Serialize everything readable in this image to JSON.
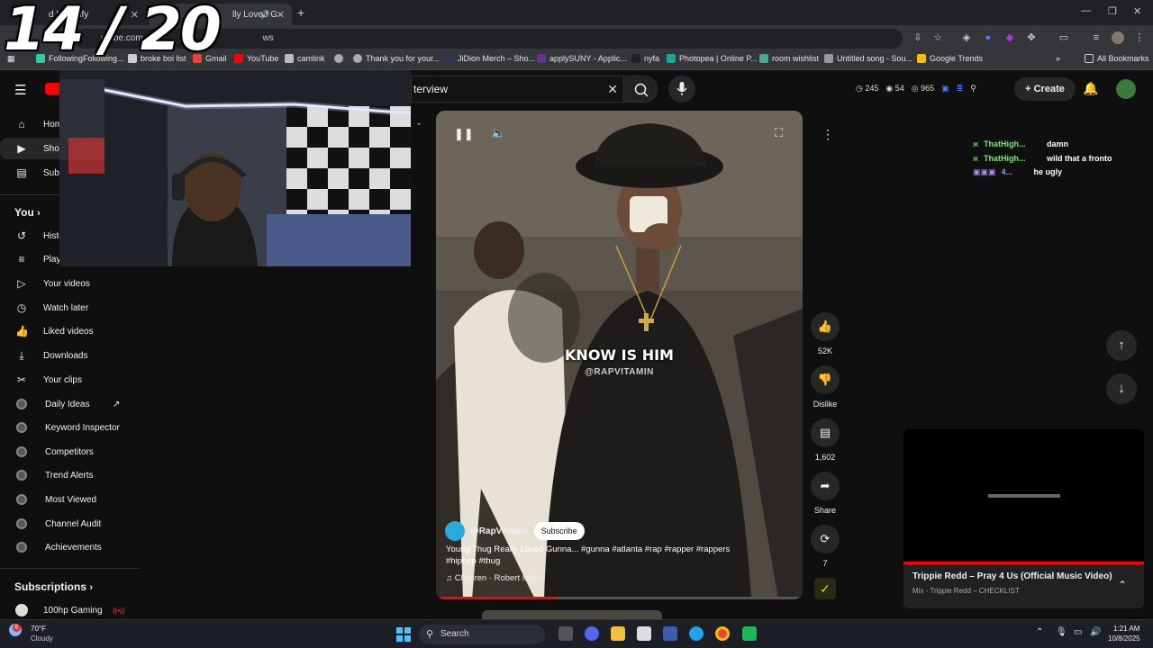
{
  "overlay": {
    "counter": "14 / 20"
  },
  "browser": {
    "tabs": [
      {
        "label": "d | Spotify",
        "active": false
      },
      {
        "label": "lly Loved G",
        "active": true
      }
    ],
    "new_tab": "+",
    "url": "utube.com",
    "url_suffix": "ws",
    "bookmarks": [
      {
        "label": "FollowingFollowing...",
        "color": "#3c9"
      },
      {
        "label": "broke boi list",
        "color": "#ccc"
      },
      {
        "label": "Gmail",
        "color": "#ea4335"
      },
      {
        "label": "YouTube",
        "color": "#f00"
      },
      {
        "label": "camlink",
        "color": "#bbb"
      },
      {
        "label": "",
        "color": "#aaa"
      },
      {
        "label": "Thank you for your...",
        "color": "#aaa"
      },
      {
        "label": "JiDion Merch – Sho...",
        "color": "#335"
      },
      {
        "label": "applySUNY - Applic...",
        "color": "#639"
      },
      {
        "label": "nyfa",
        "color": "#222"
      },
      {
        "label": "Photopea | Online P...",
        "color": "#1a9"
      },
      {
        "label": "room wishlist",
        "color": "#4a8"
      },
      {
        "label": "Untitled song - Sou...",
        "color": "#999"
      },
      {
        "label": "Google Trends",
        "color": "#fbbc04"
      }
    ],
    "all_bookmarks": "All Bookmarks"
  },
  "header": {
    "search_value": "terview",
    "stats": [
      "245",
      "54",
      "965"
    ],
    "create_label": "Create"
  },
  "sidebar": {
    "top_items": [
      {
        "label": "Hom",
        "icon": "home-icon"
      },
      {
        "label": "Shor",
        "icon": "shorts-icon"
      },
      {
        "label": "Subs",
        "icon": "subscriptions-icon"
      }
    ],
    "you_heading": "You",
    "you_items": [
      {
        "label": "Histo",
        "icon": "history-icon"
      },
      {
        "label": "Playl",
        "icon": "playlist-icon"
      },
      {
        "label": "Your videos",
        "icon": "video-icon"
      },
      {
        "label": "Watch later",
        "icon": "clock-icon"
      },
      {
        "label": "Liked videos",
        "icon": "thumbs-up-icon"
      },
      {
        "label": "Downloads",
        "icon": "download-icon"
      },
      {
        "label": "Your clips",
        "icon": "scissors-icon"
      }
    ],
    "tool_items": [
      {
        "label": "Daily Ideas"
      },
      {
        "label": "Keyword Inspector"
      },
      {
        "label": "Competitors"
      },
      {
        "label": "Trend Alerts"
      },
      {
        "label": "Most Viewed"
      },
      {
        "label": "Channel Audit"
      },
      {
        "label": "Achievements"
      }
    ],
    "subscriptions_heading": "Subscriptions",
    "subscription_items": [
      {
        "label": "100hp Gaming"
      }
    ]
  },
  "video": {
    "caption_big": "KNOW IS HIM",
    "caption_small": "@RAPVITAMIN",
    "channel": "@RapVitamin",
    "subscribe_label": "Subscribe",
    "description": "Young Thug Really Loved Gunna... #gunna #atlanta #rap #rapper #rappers #hiphop #thug",
    "music": "Children · Robert Miles",
    "progress": 0.33
  },
  "actions": {
    "likes": "52K",
    "dislike_label": "Dislike",
    "comments": "1,602",
    "share_label": "Share",
    "remix_count": "7"
  },
  "chat": [
    {
      "user": "ThatHigh...",
      "message": "damn",
      "color": "#7fe07f"
    },
    {
      "user": "ThatHigh...",
      "message": "wild that a fronto",
      "color": "#7fe07f"
    },
    {
      "user": "4...",
      "message": "he ugly",
      "color": "#7a9cf0"
    }
  ],
  "miniplayer": {
    "title": "Trippie Redd – Pray 4 Us (Official Music Video)",
    "subtitle": "Mix - Trippie Redd – CHECKLIST"
  },
  "taskbar": {
    "weather_temp": "70°F",
    "weather_desc": "Cloudy",
    "search_placeholder": "Search",
    "time": "1:21 AM",
    "date": "10/8/2025"
  },
  "colors": {
    "accent_red": "#ff0000",
    "bg": "#0f0f0f",
    "chat_name": "#7fe07f"
  }
}
